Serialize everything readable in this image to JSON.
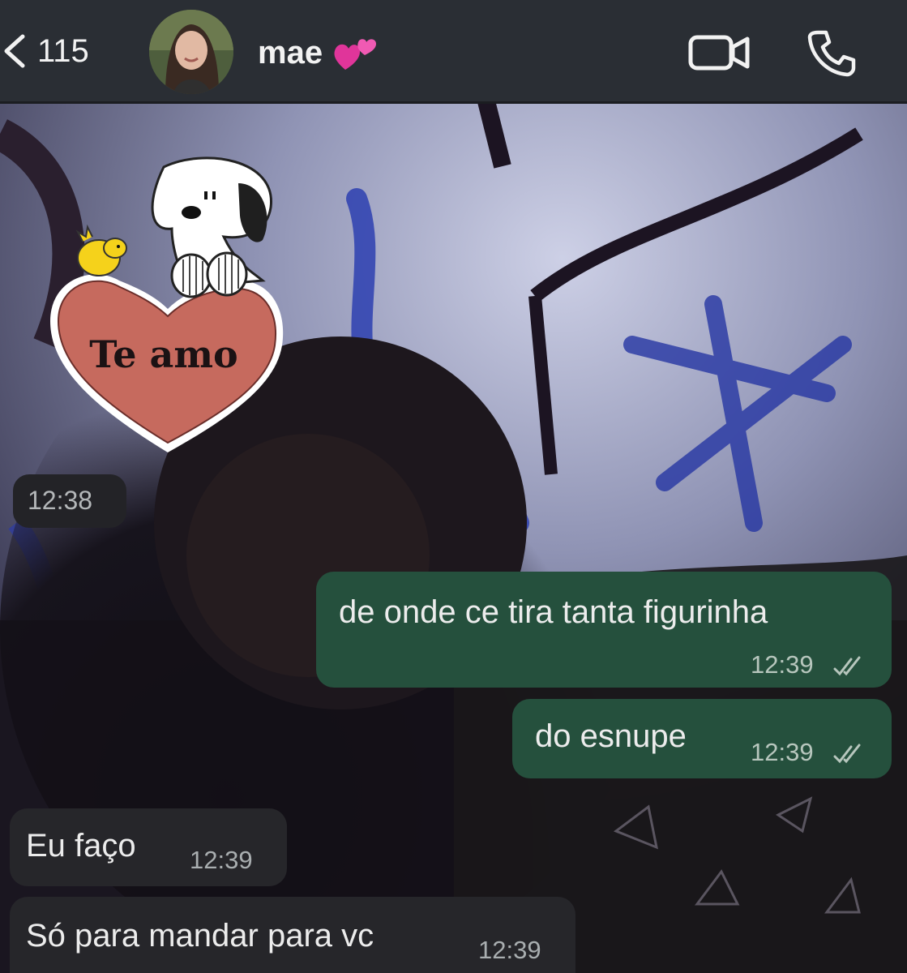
{
  "header": {
    "back_count": "115",
    "contact_name": "mae",
    "contact_emoji": "two-hearts-icon"
  },
  "sticker": {
    "text": "Te amo",
    "time": "12:38"
  },
  "messages": [
    {
      "direction": "outgoing",
      "text": "de onde ce tira tanta figurinha",
      "time": "12:39",
      "status": "read"
    },
    {
      "direction": "outgoing",
      "text": "do esnupe",
      "time": "12:39",
      "status": "read"
    },
    {
      "direction": "incoming",
      "text": "Eu faço",
      "time": "12:39"
    },
    {
      "direction": "incoming",
      "text": "Só para mandar para vc",
      "time": "12:39"
    }
  ],
  "colors": {
    "header_bg": "#2a2e34",
    "incoming_bubble": "#26262a",
    "outgoing_bubble": "#25503d",
    "heart": "#c66a5e"
  }
}
